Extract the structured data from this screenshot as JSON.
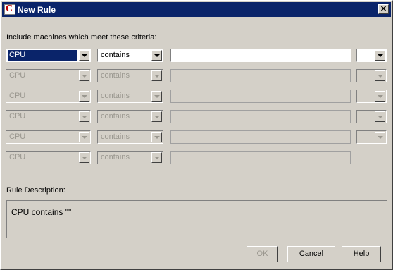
{
  "window": {
    "title": "New Rule"
  },
  "criteria_label": "Include machines which meet these criteria:",
  "rows": [
    {
      "field": "CPU",
      "operator": "contains",
      "value": "",
      "enabled": true
    },
    {
      "field": "CPU",
      "operator": "contains",
      "value": "",
      "enabled": false
    },
    {
      "field": "CPU",
      "operator": "contains",
      "value": "",
      "enabled": false
    },
    {
      "field": "CPU",
      "operator": "contains",
      "value": "",
      "enabled": false
    },
    {
      "field": "CPU",
      "operator": "contains",
      "value": "",
      "enabled": false
    },
    {
      "field": "CPU",
      "operator": "contains",
      "value": "",
      "enabled": false
    }
  ],
  "description_label": "Rule Description:",
  "description_text": "CPU contains \"\"",
  "buttons": {
    "ok": "OK",
    "cancel": "Cancel",
    "help": "Help"
  },
  "icons": {
    "app": "app-c-icon",
    "close": "close-icon",
    "dropdown": "chevron-down-icon"
  }
}
